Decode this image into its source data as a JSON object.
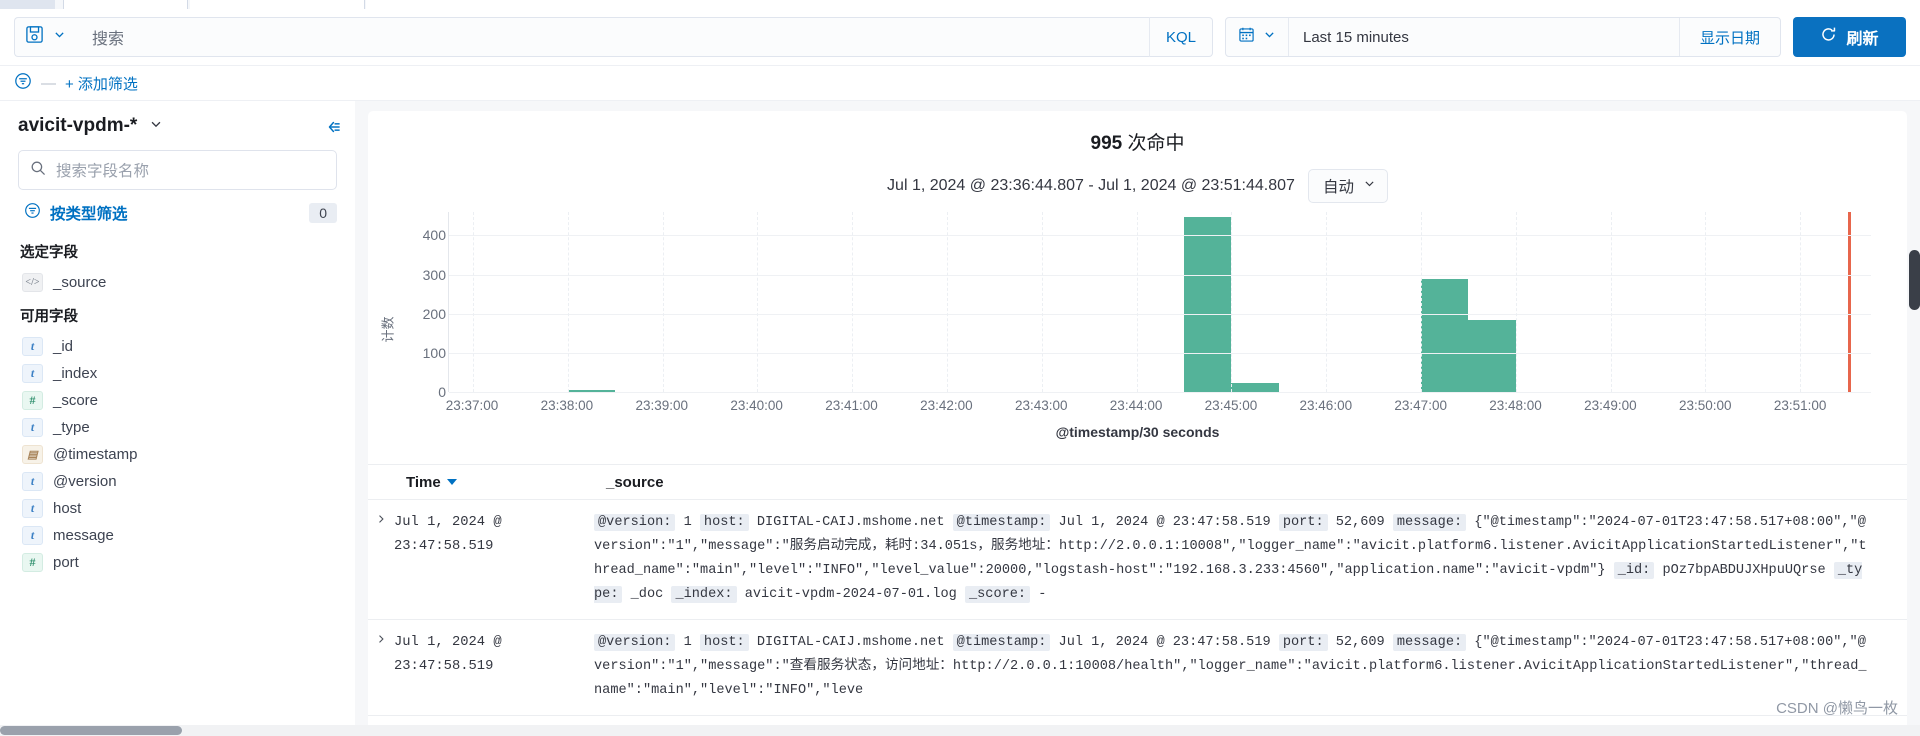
{
  "query_bar": {
    "saved_query_icon": "save-icon",
    "chevron_icon": "chevron-down-icon",
    "search_placeholder": "搜索",
    "kql_label": "KQL",
    "calendar_icon": "calendar-icon",
    "time_range": "Last 15 minutes",
    "show_dates_label": "显示日期",
    "refresh_label": "刷新",
    "refresh_icon": "refresh-icon",
    "accent_color": "#0a71c0"
  },
  "filter_bar": {
    "filter_icon": "filter-icon",
    "dash": "—",
    "add_filter_label": "+ 添加筛选"
  },
  "sidebar": {
    "index_pattern": "avicit-vpdm-*",
    "index_chevron": "chevron-down-icon",
    "collapse_icon": "collapse-sidebar-icon",
    "field_search_placeholder": "搜索字段名称",
    "search_icon": "search-icon",
    "filter_by_type_label": "按类型筛选",
    "filter_by_type_count": "0",
    "selected_fields_title": "选定字段",
    "selected_fields": [
      {
        "name": "_source",
        "type": "src",
        "glyph": "</>"
      }
    ],
    "available_fields_title": "可用字段",
    "available_fields": [
      {
        "name": "_id",
        "type": "str",
        "glyph": "t"
      },
      {
        "name": "_index",
        "type": "str",
        "glyph": "t"
      },
      {
        "name": "_score",
        "type": "num",
        "glyph": "#"
      },
      {
        "name": "_type",
        "type": "str",
        "glyph": "t"
      },
      {
        "name": "@timestamp",
        "type": "date",
        "glyph": "▤"
      },
      {
        "name": "@version",
        "type": "str",
        "glyph": "t"
      },
      {
        "name": "host",
        "type": "str",
        "glyph": "t"
      },
      {
        "name": "message",
        "type": "str",
        "glyph": "t"
      },
      {
        "name": "port",
        "type": "num",
        "glyph": "#"
      }
    ]
  },
  "main": {
    "hits_count": "995",
    "hits_suffix": "次命中",
    "range_text": "Jul 1, 2024 @ 23:36:44.807 - Jul 1, 2024 @ 23:51:44.807",
    "interval_label": "自动",
    "interval_chevron": "chevron-down-icon"
  },
  "chart_data": {
    "type": "bar",
    "title": "995 次命中",
    "xlabel": "@timestamp/30 seconds",
    "ylabel": "计数",
    "ylim": [
      0,
      460
    ],
    "yticks": [
      0,
      100,
      200,
      300,
      400
    ],
    "grid": true,
    "legend": "none",
    "bar_color": "#54b399",
    "marker_color": "#e7664c",
    "x_start": "23:36:44.807",
    "x_end": "23:51:44.807",
    "xtick_labels": [
      "23:37:00",
      "23:38:00",
      "23:39:00",
      "23:40:00",
      "23:41:00",
      "23:42:00",
      "23:43:00",
      "23:44:00",
      "23:45:00",
      "23:46:00",
      "23:47:00",
      "23:48:00",
      "23:49:00",
      "23:50:00",
      "23:51:00"
    ],
    "bars": [
      {
        "time": "23:38:00",
        "value": 4
      },
      {
        "time": "23:44:30",
        "value": 447
      },
      {
        "time": "23:45:00",
        "value": 22
      },
      {
        "time": "23:47:00",
        "value": 290
      },
      {
        "time": "23:47:30",
        "value": 185
      },
      {
        "time": "23:51:30",
        "value": 460
      }
    ]
  },
  "doc_table": {
    "columns": [
      "Time",
      "_source"
    ],
    "sort_icon": "sort-descending-icon",
    "expand_icon": "expand-row-icon",
    "rows": [
      {
        "time": "Jul 1, 2024 @ 23:47:58.519",
        "fields": [
          {
            "label": "@version:",
            "value": "1"
          },
          {
            "label": "host:",
            "value": "DIGITAL-CAIJ.mshome.net"
          },
          {
            "label": "@timestamp:",
            "value": "Jul 1, 2024 @ 23:47:58.519"
          },
          {
            "label": "port:",
            "value": "52,609"
          },
          {
            "label": "message:",
            "value": "{\"@timestamp\":\"2024-07-01T23:47:58.517+08:00\",\"@version\":\"1\",\"message\":\"服务启动完成，耗时:34.051s，服务地址：http://2.0.0.1:10008\",\"logger_name\":\"avicit.platform6.listener.AvicitApplicationStartedListener\",\"thread_name\":\"main\",\"level\":\"INFO\",\"level_value\":20000,\"logstash-host\":\"192.168.3.233:4560\",\"application.name\":\"avicit-vpdm\"}"
          },
          {
            "label": "_id:",
            "value": "pOz7bpABDUJXHpuUQrse"
          },
          {
            "label": "_type:",
            "value": "_doc"
          },
          {
            "label": "_index:",
            "value": "avicit-vpdm-2024-07-01.log"
          },
          {
            "label": "_score:",
            "value": "-"
          }
        ]
      },
      {
        "time": "Jul 1, 2024 @ 23:47:58.519",
        "fields": [
          {
            "label": "@version:",
            "value": "1"
          },
          {
            "label": "host:",
            "value": "DIGITAL-CAIJ.mshome.net"
          },
          {
            "label": "@timestamp:",
            "value": "Jul 1, 2024 @ 23:47:58.519"
          },
          {
            "label": "port:",
            "value": "52,609"
          },
          {
            "label": "message:",
            "value": "{\"@timestamp\":\"2024-07-01T23:47:58.517+08:00\",\"@version\":\"1\",\"message\":\"查看服务状态，访问地址：http://2.0.0.1:10008/health\",\"logger_name\":\"avicit.platform6.listener.AvicitApplicationStartedListener\",\"thread_name\":\"main\",\"level\":\"INFO\",\"leve"
          }
        ]
      }
    ]
  },
  "watermark": "CSDN @懒鸟一枚"
}
